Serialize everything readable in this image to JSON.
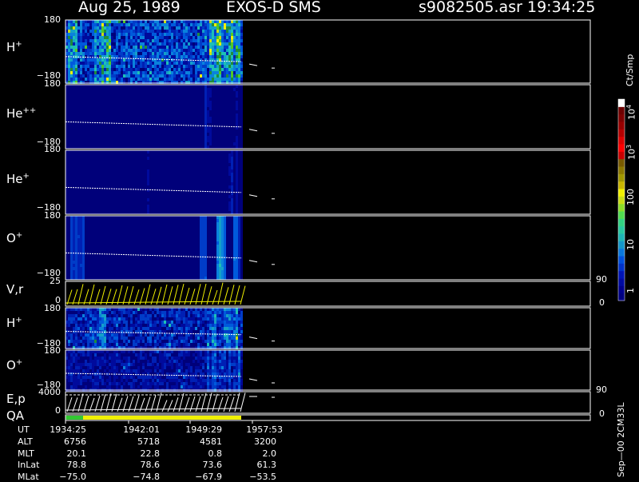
{
  "header": {
    "date": "Aug 25, 1989",
    "instrument": "EXOS-D SMS",
    "file": "s9082505.asr",
    "time": "19:34:25"
  },
  "panels": {
    "h_plus": {
      "ion": "H",
      "charge": "+",
      "ymax": "180",
      "ymin": "−180"
    },
    "he_pp": {
      "ion": "He",
      "charge": "++",
      "ymax": "180",
      "ymin": "−180"
    },
    "he_plus": {
      "ion": "He",
      "charge": "+",
      "ymax": "180",
      "ymin": "−180"
    },
    "o_plus": {
      "ion": "O",
      "charge": "+",
      "ymax": "180",
      "ymin": "−180"
    },
    "vr": {
      "label": "V,r",
      "ymax": "25",
      "ymin": "0",
      "rmax": "90",
      "rmin": "0"
    },
    "h_plus2": {
      "ion": "H",
      "charge": "+",
      "ymax": "180",
      "ymin": "−180"
    },
    "o_plus2": {
      "ion": "O",
      "charge": "+",
      "ymax": "180",
      "ymin": "−180"
    },
    "ep": {
      "label": "E,p",
      "ymax": "4000",
      "ymin": "0",
      "rmax": "90",
      "rmin": "0"
    },
    "qa": {
      "label": "QA"
    }
  },
  "colorbar": {
    "unit": "Ct/Smp",
    "labels": {
      "e4_base": "10",
      "e4_exp": "4",
      "e3_base": "10",
      "e3_exp": "3",
      "l100": "100",
      "l10": "10",
      "l1": "1"
    },
    "colors": [
      "#000080",
      "#00008c",
      "#000aa0",
      "#0014b4",
      "#0032c8",
      "#0050dc",
      "#0a78dc",
      "#1496c8",
      "#1eb4b4",
      "#28c8a0",
      "#32d282",
      "#50dc50",
      "#8cdc28",
      "#c8dc14",
      "#f0f000",
      "#c8b400",
      "#a09600",
      "#8c7800",
      "#785a00",
      "#c80000",
      "#ff0000",
      "#dc0000",
      "#b40000",
      "#960000",
      "#800000",
      "#6e0000",
      "#ffffff"
    ]
  },
  "footer": {
    "row_labels": [
      "UT",
      "ALT",
      "MLT",
      "InLat",
      "MLat"
    ],
    "columns": [
      [
        "1934:25",
        "6756",
        "20.1",
        "78.8",
        "−75.0"
      ],
      [
        "1942:01",
        "5718",
        "22.8",
        "78.6",
        "−74.8"
      ],
      [
        "1949:29",
        "4581",
        "0.8",
        "73.6",
        "−67.9"
      ],
      [
        "1957:53",
        "3200",
        "2.0",
        "61.3",
        "−53.5"
      ]
    ],
    "version": "Sep—00 2CM33L"
  },
  "chart_data": {
    "type": "heatmap",
    "title": "Aug 25, 1989   EXOS-D SMS",
    "x_ut_ticks": [
      "1934:25",
      "1942:01",
      "1949:29",
      "1957:53"
    ],
    "panels": [
      {
        "name": "H+",
        "ylim": [
          -180,
          180
        ],
        "level": "moderate-high"
      },
      {
        "name": "He++",
        "ylim": [
          -180,
          180
        ],
        "level": "low"
      },
      {
        "name": "He+",
        "ylim": [
          -180,
          180
        ],
        "level": "low-sparse"
      },
      {
        "name": "O+",
        "ylim": [
          -180,
          180
        ],
        "level": "low-with-bursts"
      },
      {
        "name": "V,r",
        "ylim": [
          0,
          25
        ],
        "right_ylim": [
          0,
          90
        ],
        "type": "line"
      },
      {
        "name": "H+",
        "ylim": [
          -180,
          180
        ],
        "level": "moderate-high"
      },
      {
        "name": "O+",
        "ylim": [
          -180,
          180
        ],
        "level": "moderate"
      },
      {
        "name": "E,p",
        "ylim": [
          0,
          4000
        ],
        "right_ylim": [
          0,
          90
        ],
        "type": "line"
      },
      {
        "name": "QA",
        "type": "status"
      }
    ],
    "colorbar": {
      "unit": "Ct/Smp",
      "scale": "log",
      "range": [
        1,
        10000
      ]
    }
  }
}
